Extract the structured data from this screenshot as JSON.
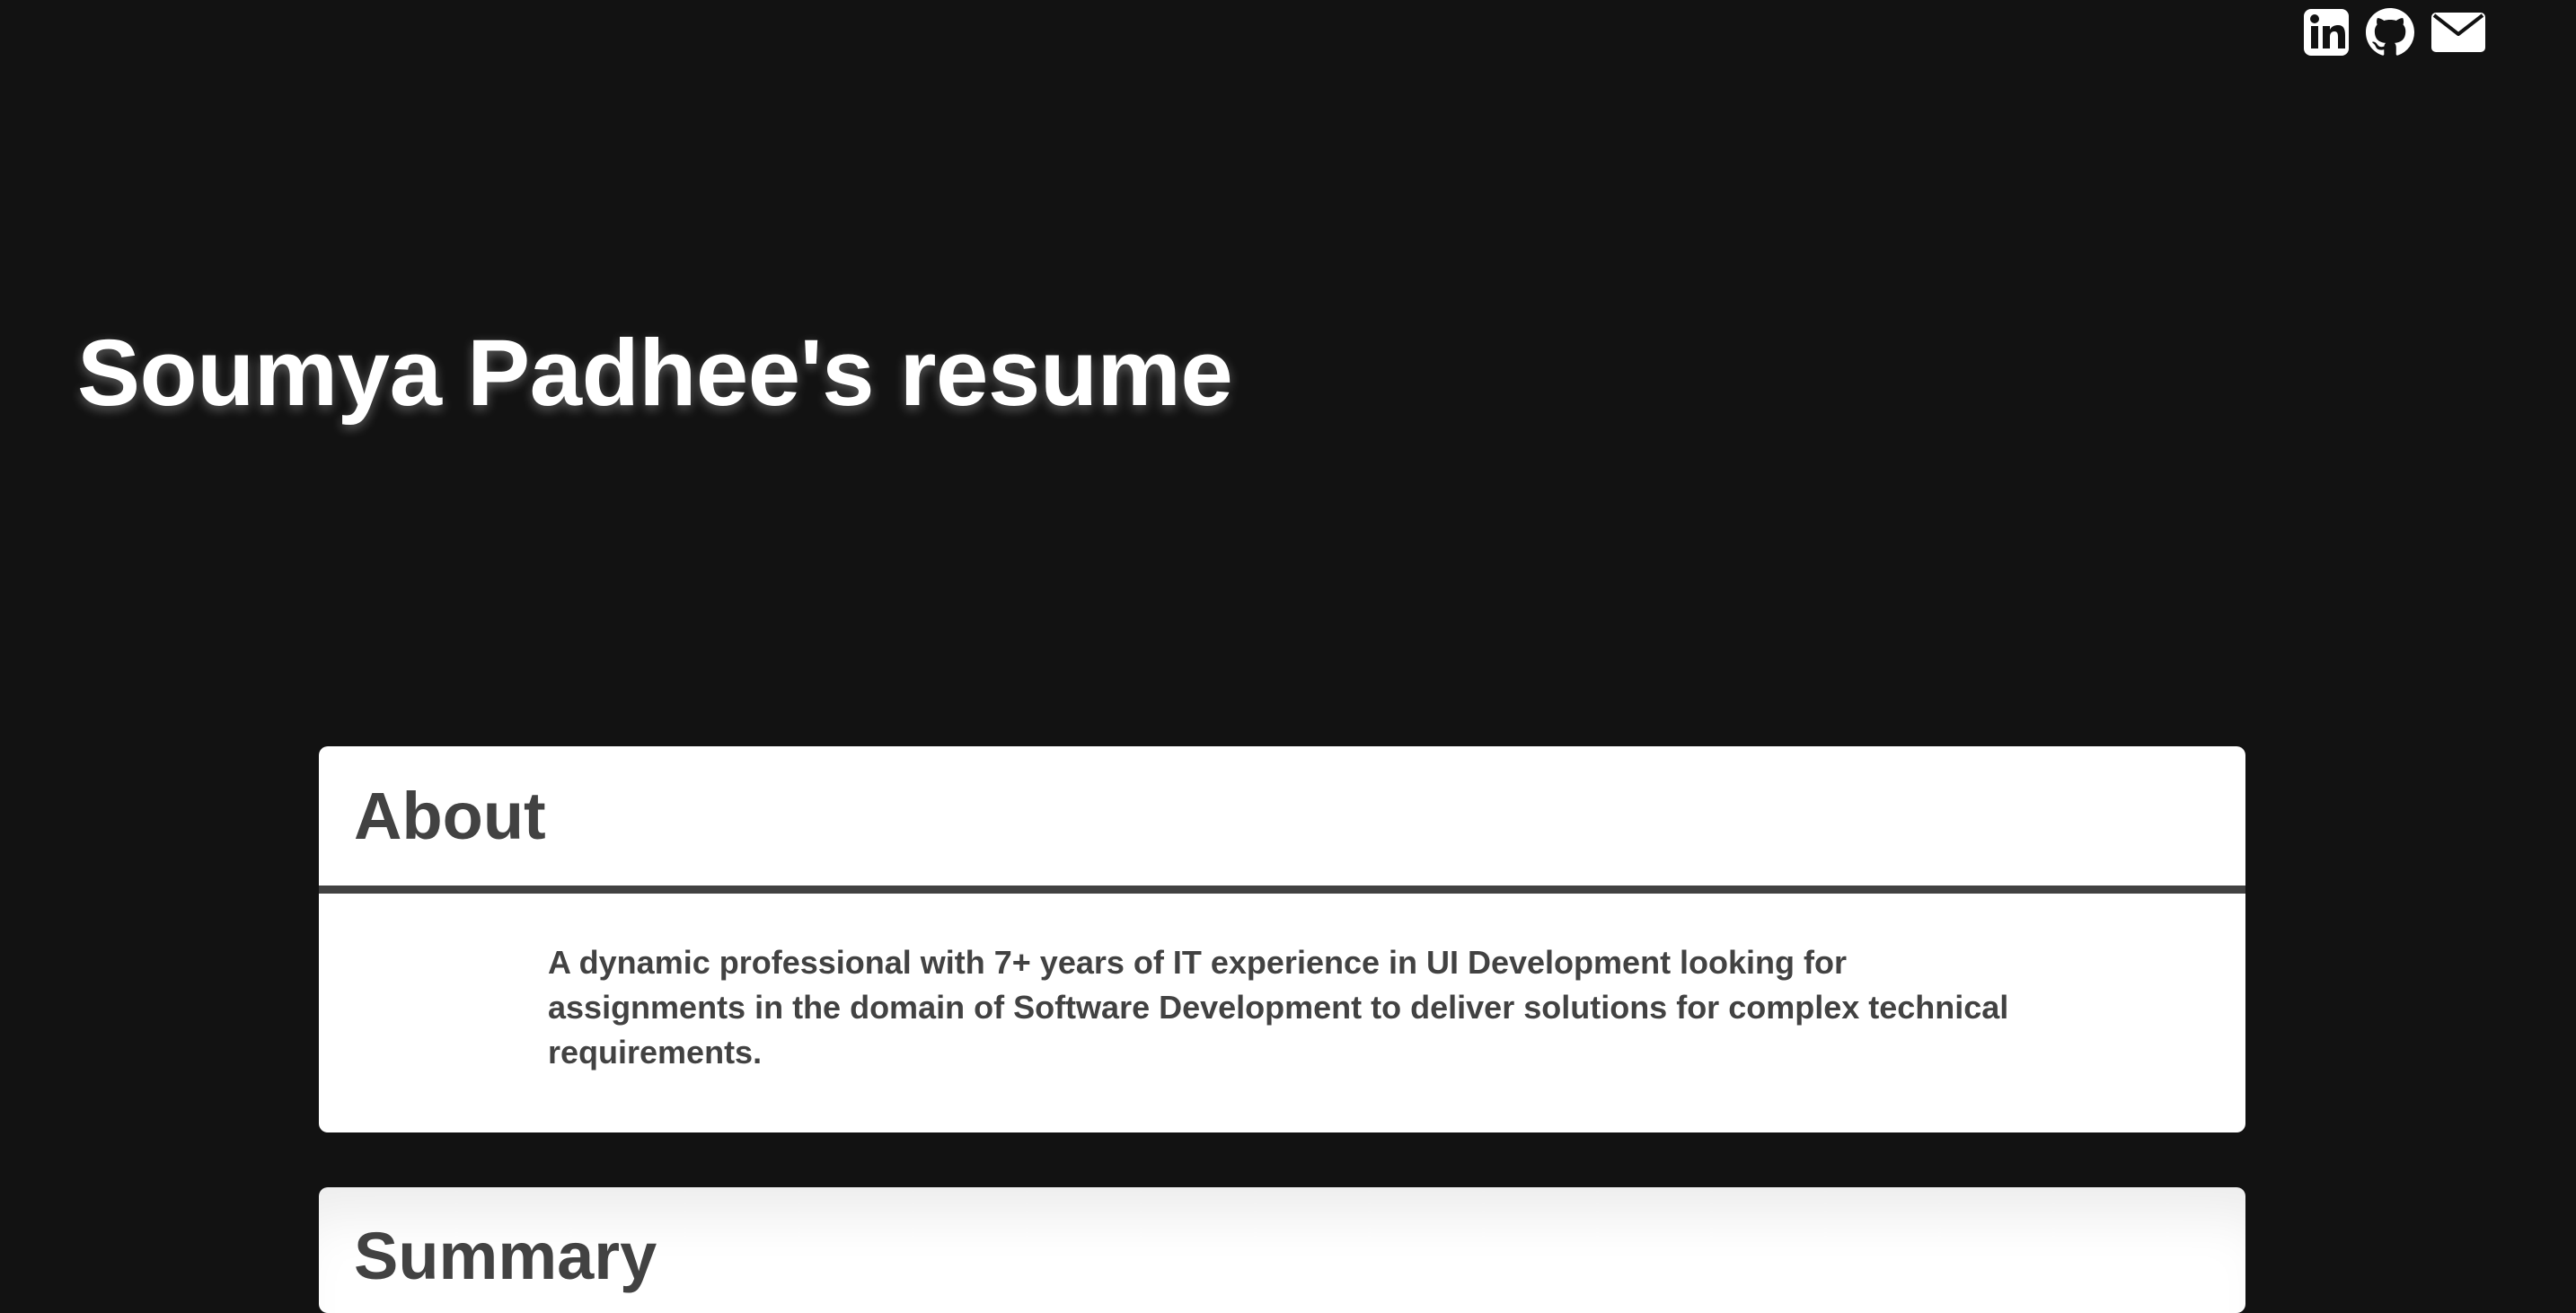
{
  "page": {
    "title": "Soumya Padhee's resume"
  },
  "social": {
    "links": [
      {
        "icon": "linkedin-icon",
        "label": "LinkedIn"
      },
      {
        "icon": "github-icon",
        "label": "GitHub"
      },
      {
        "icon": "email-icon",
        "label": "Email"
      }
    ]
  },
  "sections": {
    "about": {
      "heading": "About",
      "text": "A dynamic professional with 7+ years of IT experience in UI Development looking for assignments in the domain of Software Development to deliver solutions for complex technical requirements."
    },
    "summary": {
      "heading": "Summary"
    }
  },
  "colors": {
    "background": "#121212",
    "card": "#ffffff",
    "text_dark": "#424242",
    "hero_text": "#ffffff",
    "icon": "#ffffff"
  }
}
